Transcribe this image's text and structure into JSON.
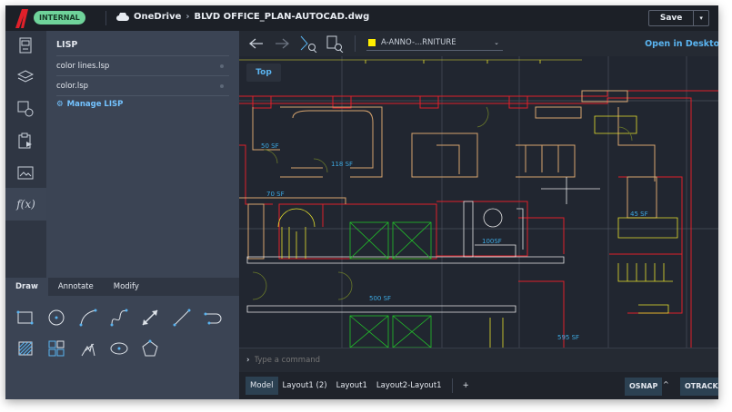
{
  "header": {
    "badge": "INTERNAL",
    "location": "OneDrive",
    "separator": "›",
    "file": "BLVD OFFICE_PLAN-AUTOCAD.dwg",
    "save_label": "Save"
  },
  "rail": {
    "items": [
      "sheet-icon",
      "layers-icon",
      "block-icon",
      "clipboard-icon",
      "image-icon",
      "function-icon"
    ],
    "function_label": "f(x)"
  },
  "lisp_panel": {
    "title": "LISP",
    "files": [
      "color lines.lsp",
      "color.lsp"
    ],
    "manage_label": "Manage LISP"
  },
  "tool_palette": {
    "tabs": [
      "Draw",
      "Annotate",
      "Modify"
    ],
    "active_tab": "Draw",
    "tools": [
      "rectangle",
      "circle",
      "arc",
      "spline",
      "dimension",
      "line",
      "polyline",
      "hatch",
      "array",
      "sketch",
      "ellipse",
      "polygon"
    ]
  },
  "toolbar": {
    "layer_name": "A-ANNO-...RNITURE",
    "layer_color": "#ffee00",
    "open_desktop": "Open in Desktop"
  },
  "canvas": {
    "view_label": "Top",
    "rooms": [
      {
        "label": "50 SF"
      },
      {
        "label": "118 SF"
      },
      {
        "label": "70 SF"
      },
      {
        "label": "100SF"
      },
      {
        "label": "45 SF"
      },
      {
        "label": "500 SF"
      },
      {
        "label": "595 SF"
      }
    ]
  },
  "command": {
    "prompt": "›",
    "placeholder": "Type a command"
  },
  "status": {
    "tabs": [
      "Model",
      "Layout1 (2)",
      "Layout1",
      "Layout2-Layout1"
    ],
    "active": "Model",
    "add": "+",
    "osnap": "OSNAP",
    "caret": "^",
    "otrack": "OTRACK"
  },
  "colors": {
    "accent": "#5ab4f0",
    "badge": "#6fd39a",
    "walls": "#e0202a",
    "furniture": "#d7a46e",
    "stairs": "#e6e22e",
    "elevator": "#22c22a"
  }
}
